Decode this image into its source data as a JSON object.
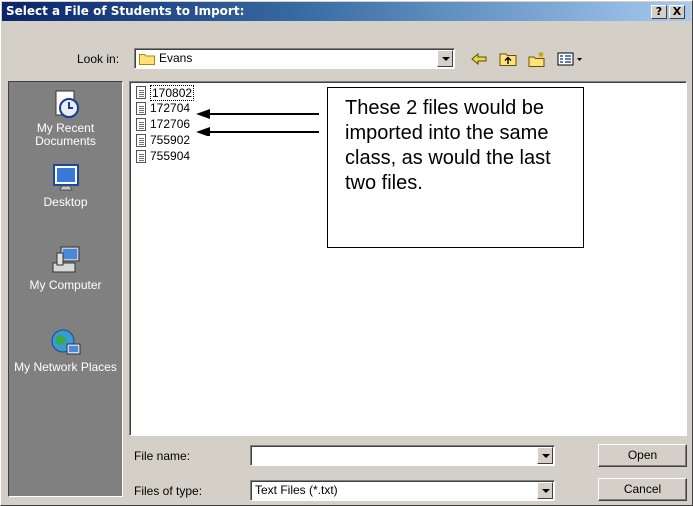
{
  "window": {
    "title": "Select a File of Students to Import:",
    "help_label": "?",
    "close_label": "X"
  },
  "lookin": {
    "label": "Look in:",
    "value": "Evans"
  },
  "toolbar": {
    "back_glyph": "⇦",
    "up_glyph": "⮬",
    "new_folder_glyph": "✱",
    "views_glyph": "▦▾"
  },
  "places": [
    {
      "label": "My Recent Documents",
      "icon": "recent-documents-icon"
    },
    {
      "label": "Desktop",
      "icon": "desktop-icon"
    },
    {
      "label": "My Computer",
      "icon": "my-computer-icon"
    },
    {
      "label": "My Network Places",
      "icon": "network-places-icon"
    }
  ],
  "files": [
    "170802",
    "172704",
    "172706",
    "755902",
    "755904"
  ],
  "annotation": {
    "text": "These 2 files would be imported into the same class, as would the last two files."
  },
  "filename": {
    "label": "File name:",
    "value": ""
  },
  "filetype": {
    "label": "Files of type:",
    "value": "Text Files (*.txt)"
  },
  "buttons": {
    "open": "Open",
    "cancel": "Cancel"
  },
  "colors": {
    "title_start": "#0a246a",
    "title_end": "#a6caf0",
    "face": "#d4d0c8",
    "places_bg": "#808080"
  }
}
